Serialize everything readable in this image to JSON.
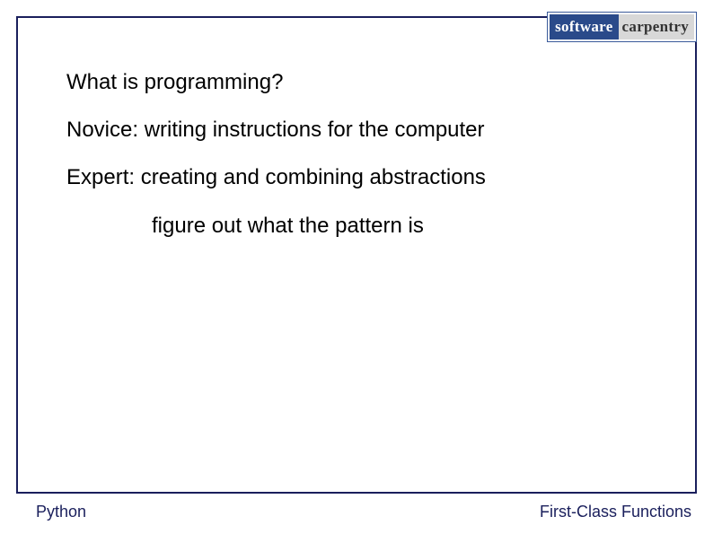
{
  "logo": {
    "left": "software",
    "right": "carpentry"
  },
  "content": {
    "lines": [
      {
        "text": "What is programming?",
        "indent": false
      },
      {
        "text": "Novice:  writing instructions for the computer",
        "indent": false
      },
      {
        "text": "Expert:  creating and combining abstractions",
        "indent": false
      },
      {
        "text": "figure out what the pattern is",
        "indent": true
      }
    ]
  },
  "footer": {
    "left": "Python",
    "right": "First-Class Functions"
  }
}
